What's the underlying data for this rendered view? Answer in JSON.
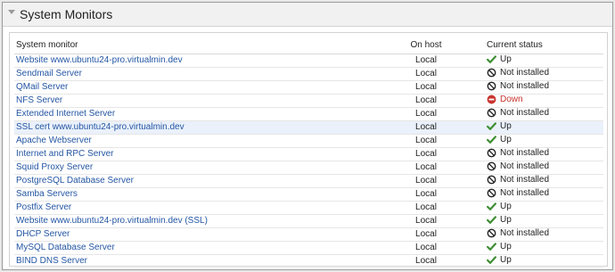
{
  "title": "System Monitors",
  "columns": {
    "monitor": "System monitor",
    "host": "On host",
    "status": "Current status"
  },
  "colors": {
    "up": "#3f8f33",
    "down": "#c8352f",
    "link": "#2456a4"
  },
  "rows": [
    {
      "name": "Website www.ubuntu24-pro.virtualmin.dev",
      "host": "Local",
      "status": "Up",
      "state": "up"
    },
    {
      "name": "Sendmail Server",
      "host": "Local",
      "status": "Not installed",
      "state": "na"
    },
    {
      "name": "QMail Server",
      "host": "Local",
      "status": "Not installed",
      "state": "na"
    },
    {
      "name": "NFS Server",
      "host": "Local",
      "status": "Down",
      "state": "down"
    },
    {
      "name": "Extended Internet Server",
      "host": "Local",
      "status": "Not installed",
      "state": "na"
    },
    {
      "name": "SSL cert www.ubuntu24-pro.virtualmin.dev",
      "host": "Local",
      "status": "Up",
      "state": "up"
    },
    {
      "name": "Apache Webserver",
      "host": "Local",
      "status": "Up",
      "state": "up"
    },
    {
      "name": "Internet and RPC Server",
      "host": "Local",
      "status": "Not installed",
      "state": "na"
    },
    {
      "name": "Squid Proxy Server",
      "host": "Local",
      "status": "Not installed",
      "state": "na"
    },
    {
      "name": "PostgreSQL Database Server",
      "host": "Local",
      "status": "Not installed",
      "state": "na"
    },
    {
      "name": "Samba Servers",
      "host": "Local",
      "status": "Not installed",
      "state": "na"
    },
    {
      "name": "Postfix Server",
      "host": "Local",
      "status": "Up",
      "state": "up"
    },
    {
      "name": "Website www.ubuntu24-pro.virtualmin.dev (SSL)",
      "host": "Local",
      "status": "Up",
      "state": "up"
    },
    {
      "name": "DHCP Server",
      "host": "Local",
      "status": "Not installed",
      "state": "na"
    },
    {
      "name": "MySQL Database Server",
      "host": "Local",
      "status": "Up",
      "state": "up"
    },
    {
      "name": "BIND DNS Server",
      "host": "Local",
      "status": "Up",
      "state": "up"
    }
  ]
}
